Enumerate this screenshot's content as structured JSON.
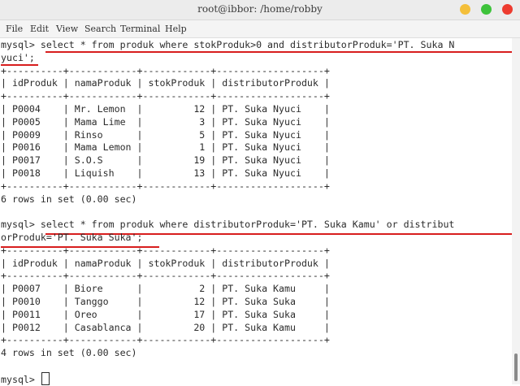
{
  "window": {
    "title": "root@ibbor: /home/robby",
    "colors": {
      "minimize": "#f4bf3a",
      "maximize": "#3ec33b",
      "close": "#ed3b2f"
    }
  },
  "menu": [
    "File",
    "Edit",
    "View",
    "Search",
    "Terminal",
    "Help"
  ],
  "terminal": {
    "lines": [
      "mysql> select * from produk where stokProduk>0 and distributorProduk='PT. Suka N",
      "yuci';",
      "+----------+------------+------------+-------------------+",
      "| idProduk | namaProduk | stokProduk | distributorProduk |",
      "+----------+------------+------------+-------------------+",
      "| P0004    | Mr. Lemon  |         12 | PT. Suka Nyuci    |",
      "| P0005    | Mama Lime  |          3 | PT. Suka Nyuci    |",
      "| P0009    | Rinso      |          5 | PT. Suka Nyuci    |",
      "| P0016    | Mama Lemon |          1 | PT. Suka Nyuci    |",
      "| P0017    | S.O.S      |         19 | PT. Suka Nyuci    |",
      "| P0018    | Liquish    |         13 | PT. Suka Nyuci    |",
      "+----------+------------+------------+-------------------+",
      "6 rows in set (0.00 sec)",
      "",
      "mysql> select * from produk where distributorProduk='PT. Suka Kamu' or distribut",
      "orProduk='PT. Suka Suka';",
      "+----------+------------+------------+-------------------+",
      "| idProduk | namaProduk | stokProduk | distributorProduk |",
      "+----------+------------+------------+-------------------+",
      "| P0007    | Biore      |          2 | PT. Suka Kamu     |",
      "| P0010    | Tanggo     |         12 | PT. Suka Suka     |",
      "| P0011    | Oreo       |         17 | PT. Suka Suka     |",
      "| P0012    | Casablanca |         20 | PT. Suka Kamu     |",
      "+----------+------------+------------+-------------------+",
      "4 rows in set (0.00 sec)",
      "",
      "mysql> "
    ]
  }
}
